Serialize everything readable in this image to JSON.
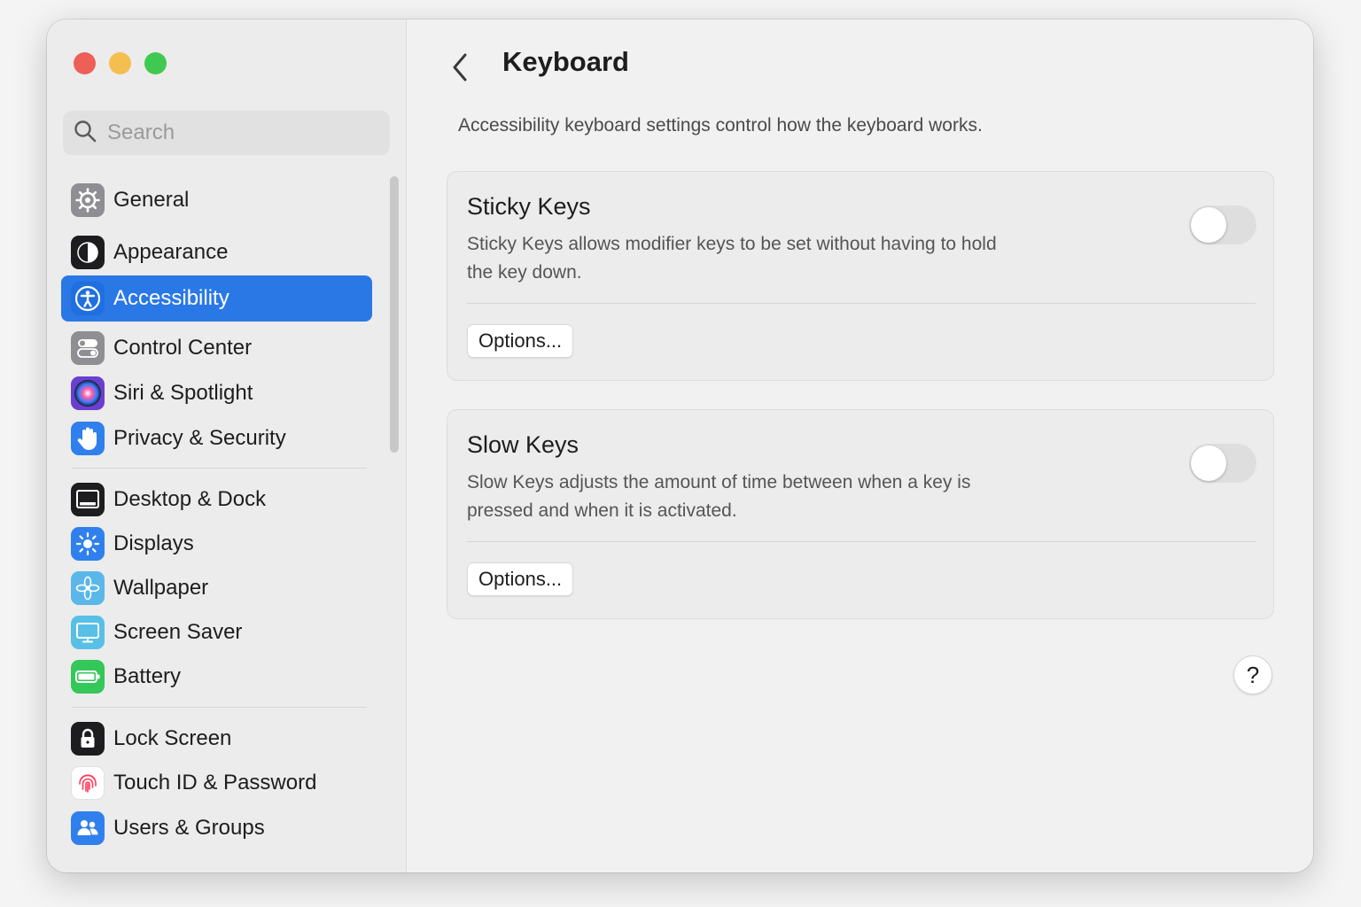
{
  "window": {
    "traffic_lights": [
      {
        "name": "close",
        "color": "#ee5f57"
      },
      {
        "name": "minimize",
        "color": "#f4bf4f"
      },
      {
        "name": "zoom",
        "color": "#3fc950"
      }
    ]
  },
  "sidebar": {
    "search_placeholder": "Search",
    "selected": "Accessibility",
    "accent_color": "#2a78e6",
    "items": [
      {
        "label": "General",
        "icon": "gear-icon",
        "color": "#8e8e93"
      },
      {
        "label": "Appearance",
        "icon": "appearance-icon",
        "color": "#1d1d1f"
      },
      {
        "label": "Accessibility",
        "icon": "accessibility-icon",
        "color": "#1f6fe0"
      },
      {
        "label": "Control Center",
        "icon": "control-center-icon",
        "color": "#8e8e93"
      },
      {
        "label": "Siri & Spotlight",
        "icon": "siri-icon",
        "color": "#6a3fd0"
      },
      {
        "label": "Privacy & Security",
        "icon": "hand-icon",
        "color": "#2f80ed"
      },
      {
        "label": "Desktop & Dock",
        "icon": "dock-icon",
        "color": "#1d1d1f"
      },
      {
        "label": "Displays",
        "icon": "sun-icon",
        "color": "#2f80ed"
      },
      {
        "label": "Wallpaper",
        "icon": "flower-icon",
        "color": "#5ab7e8"
      },
      {
        "label": "Screen Saver",
        "icon": "screen-icon",
        "color": "#58c0e6"
      },
      {
        "label": "Battery",
        "icon": "battery-icon",
        "color": "#34c759"
      },
      {
        "label": "Lock Screen",
        "icon": "lock-icon",
        "color": "#1d1d1f"
      },
      {
        "label": "Touch ID & Password",
        "icon": "fingerprint-icon",
        "color": "#ffffff"
      },
      {
        "label": "Users & Groups",
        "icon": "users-icon",
        "color": "#2f80ed"
      }
    ]
  },
  "main": {
    "title": "Keyboard",
    "intro": "Accessibility keyboard settings control how the keyboard works.",
    "cards": [
      {
        "title": "Sticky Keys",
        "description": "Sticky Keys allows modifier keys to be set without having to hold the key down.",
        "enabled": false,
        "options_label": "Options..."
      },
      {
        "title": "Slow Keys",
        "description": "Slow Keys adjusts the amount of time between when a key is pressed and when it is activated.",
        "enabled": false,
        "options_label": "Options..."
      }
    ],
    "help_label": "?"
  }
}
